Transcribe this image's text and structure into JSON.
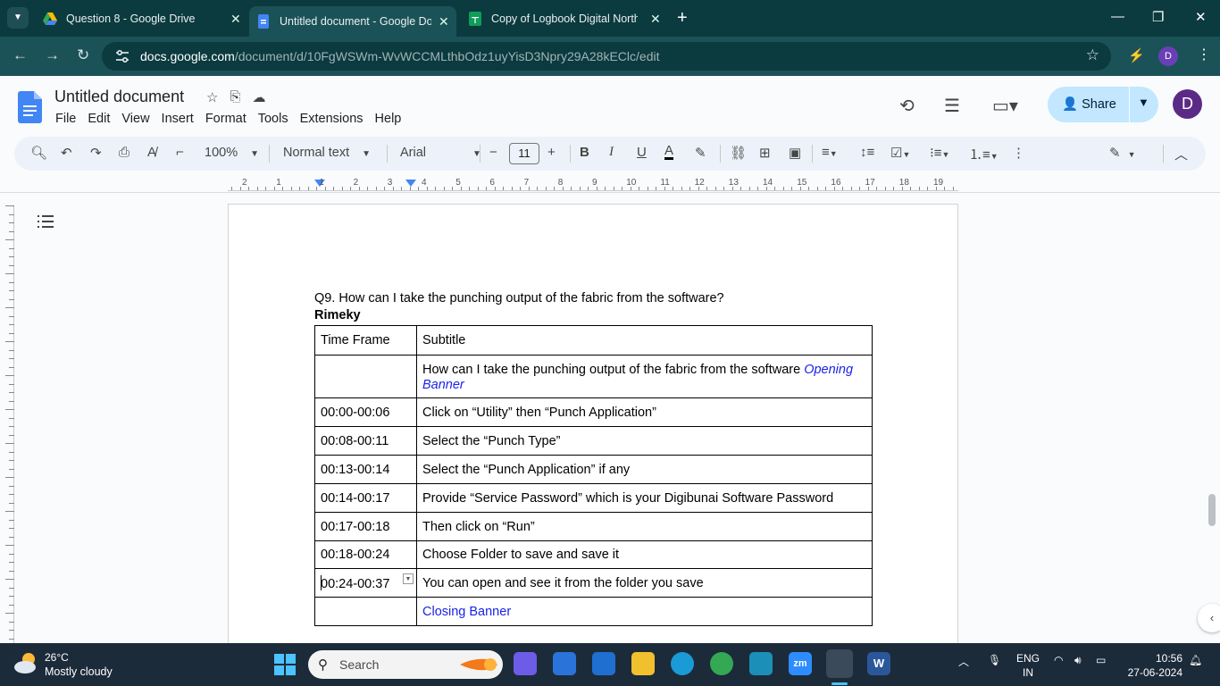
{
  "browser": {
    "tabs": [
      {
        "title": "Question 8 - Google Drive",
        "active": false
      },
      {
        "title": "Untitled document - Google Do",
        "active": true
      },
      {
        "title": "Copy of Logbook Digital North",
        "active": false
      }
    ],
    "url_host": "docs.google.com",
    "url_path": "/document/d/10FgWSWm-WvWCCMLthbOdz1uyYisD3Npry29A28kEClc/edit",
    "profile_initial": "D"
  },
  "docs": {
    "title": "Untitled document",
    "menu": [
      "File",
      "Edit",
      "View",
      "Insert",
      "Format",
      "Tools",
      "Extensions",
      "Help"
    ],
    "share_label": "Share",
    "avatar_initial": "D",
    "toolbar": {
      "zoom": "100%",
      "style": "Normal text",
      "font": "Arial",
      "font_size": "11"
    },
    "ruler_numbers": [
      "2",
      "1",
      "1",
      "2",
      "3",
      "4",
      "5",
      "6",
      "7",
      "8",
      "9",
      "10",
      "11",
      "12",
      "13",
      "14",
      "15",
      "16",
      "17",
      "18",
      "19"
    ]
  },
  "document": {
    "question": "Q9. How can I take the punching output of the fabric from the software?",
    "author": "Rimeky",
    "table": {
      "headers": [
        "Time Frame",
        "Subtitle"
      ],
      "rows": [
        {
          "time": "",
          "text": "How can I take the punching output of the fabric from the software ",
          "link": "Opening Banner"
        },
        {
          "time": "00:00-00:06",
          "text": "Click on “Utility” then “Punch Application”"
        },
        {
          "time": "00:08-00:11",
          "text": "Select the “Punch Type”"
        },
        {
          "time": "00:13-00:14",
          "text": "Select the “Punch Application” if any"
        },
        {
          "time": "00:14-00:17",
          "text": "Provide “Service Password” which is your Digibunai Software Password"
        },
        {
          "time": "00:17-00:18",
          "text": "Then click on “Run”"
        },
        {
          "time": "00:18-00:24",
          "text": "Choose Folder to save and save it"
        },
        {
          "time": "00:24-00:37",
          "text": "You can open and see it from the folder you save"
        },
        {
          "time": "",
          "text": "Closing Banner"
        }
      ]
    }
  },
  "taskbar": {
    "temperature": "26°C",
    "weather": "Mostly cloudy",
    "search_placeholder": "Search",
    "language": "ENG",
    "region": "IN",
    "time": "10:56",
    "date": "27-06-2024"
  },
  "colors": {
    "tab_strip": "#0b3a3f",
    "address_bar": "#1b5257",
    "share_button": "#c2e7ff",
    "link_blue": "#1a24e6"
  }
}
